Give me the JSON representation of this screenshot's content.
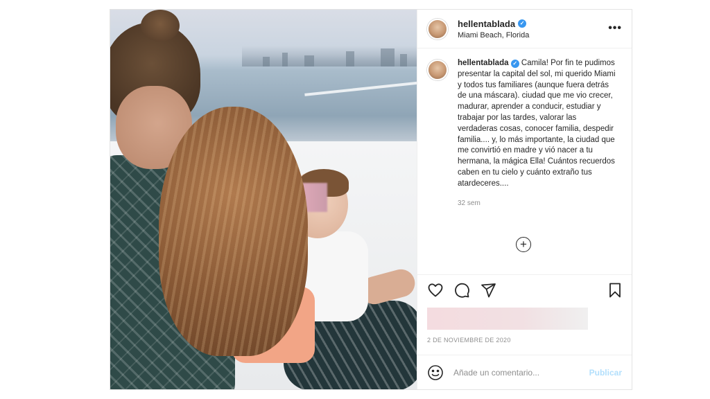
{
  "header": {
    "username": "hellentablada",
    "location": "Miami Beach, Florida",
    "more": "•••",
    "verified_mark": "✓"
  },
  "caption": {
    "username": "hellentablada",
    "text": "Camila! Por fin te pudimos presentar la capital del sol, mi querido Miami y todos tus familiares (aunque fuera detrás de una máscara). ciudad que me vio crecer, madurar, aprender a conducir, estudiar y trabajar por las tardes, valorar las verdaderas cosas, conocer familia, despedir familia.... y, lo más importante, la ciudad que me convirtió en madre y vió nacer a tu hermana, la mágica Ella! Cuántos recuerdos caben en tu cielo y cuánto extraño tus atardeceres....",
    "time_ago": "32 sem"
  },
  "load_more_icon": "+",
  "icons": {
    "like": "heart-icon",
    "comment": "comment-icon",
    "share": "paper-plane-icon",
    "save": "bookmark-icon",
    "emoji": "smiley-icon",
    "load_more": "plus-circle-icon"
  },
  "date": "2 DE NOVIEMBRE DE 2020",
  "comment_box": {
    "placeholder": "Añade un comentario...",
    "publish_label": "Publicar"
  },
  "colors": {
    "verified": "#3897f0",
    "publish": "#b2dffc",
    "muted": "#8e8e8e"
  }
}
